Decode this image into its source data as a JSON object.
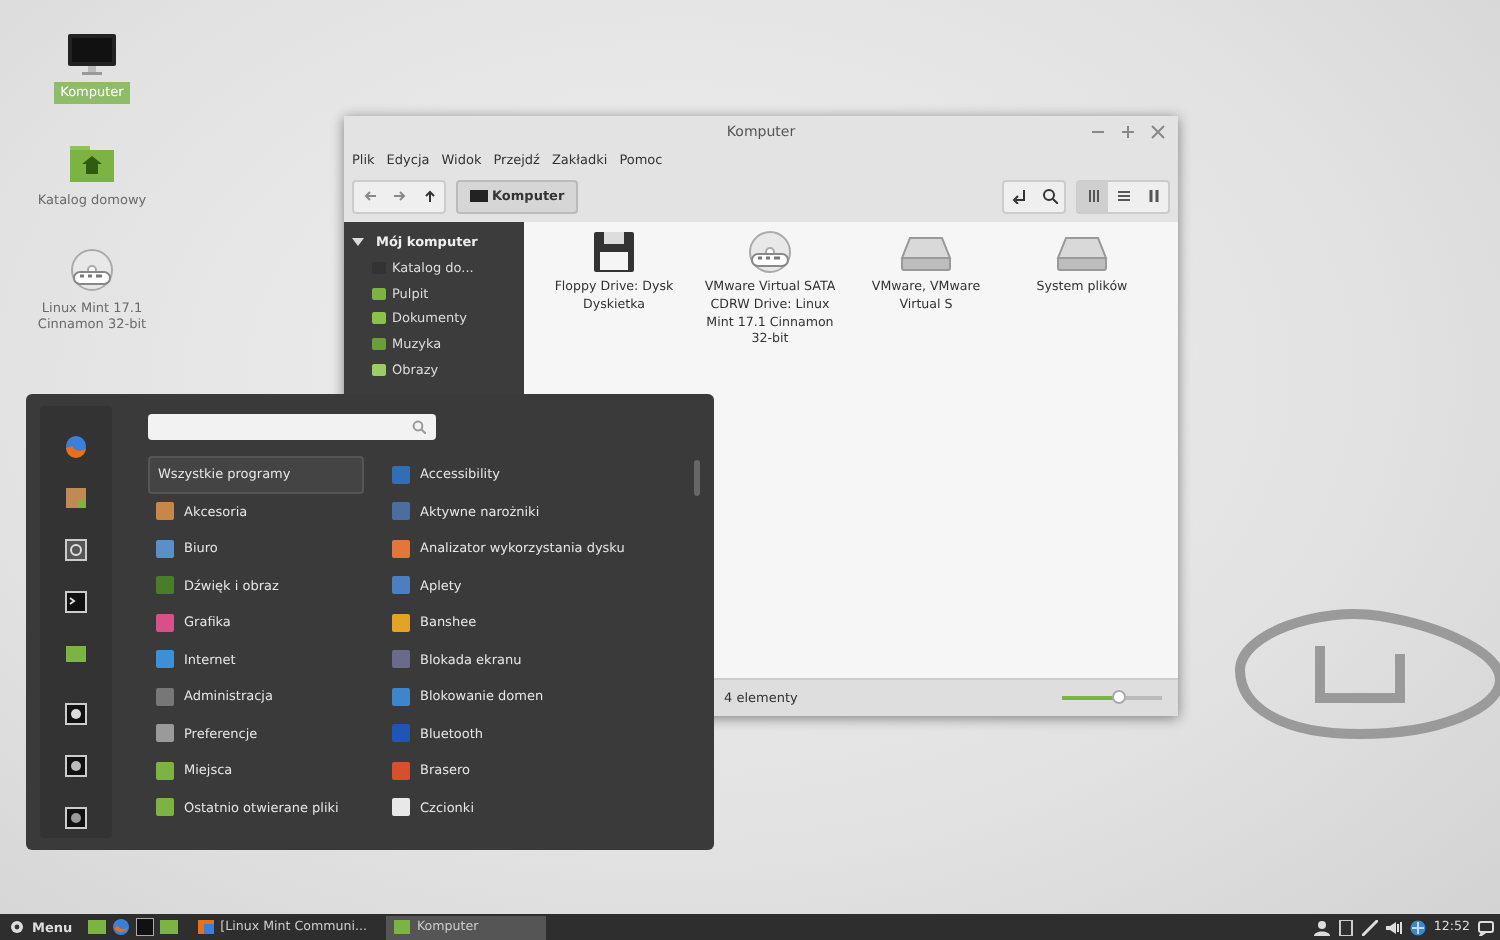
{
  "desktop_icons": [
    {
      "label": "Komputer",
      "kind": "monitor",
      "selected": true
    },
    {
      "label": "Katalog domowy",
      "kind": "folder",
      "selected": false
    },
    {
      "label": "Linux Mint 17.1 Cinnamon 32-bit",
      "kind": "dvd",
      "selected": false
    }
  ],
  "file_manager": {
    "title": "Komputer",
    "menu": [
      "Plik",
      "Edycja",
      "Widok",
      "Przejdź",
      "Zakładki",
      "Pomoc"
    ],
    "path_button": "Komputer",
    "view_modes": [
      {
        "kind": "icons",
        "selected": true
      },
      {
        "kind": "list",
        "selected": false
      },
      {
        "kind": "compact",
        "selected": false
      }
    ],
    "sidebar": {
      "heading": "Mój komputer",
      "expanded": true,
      "items": [
        {
          "label": "Katalog do...",
          "color": "#333333"
        },
        {
          "label": "Pulpit",
          "color": "#7cb342"
        },
        {
          "label": "Dokumenty",
          "color": "#8bc34a"
        },
        {
          "label": "Muzyka",
          "color": "#689f38"
        },
        {
          "label": "Obrazy",
          "color": "#9ccc65"
        }
      ]
    },
    "files": [
      {
        "label": "Floppy Drive: Dysk Dyskietka",
        "kind": "floppy"
      },
      {
        "label": "VMware Virtual SATA CDRW Drive: Linux Mint 17.1 Cinnamon 32-bit",
        "kind": "dvd"
      },
      {
        "label": "VMware, VMware Virtual S",
        "kind": "drive"
      },
      {
        "label": "System plików",
        "kind": "drive"
      }
    ],
    "status_bar": {
      "text": "4 elementy",
      "zoom": {
        "level": 0.55
      }
    }
  },
  "menu": {
    "categories": [
      {
        "label": "Wszystkie programy",
        "selected": true
      },
      {
        "label": "Akcesoria",
        "selected": false,
        "color": "#c8874a"
      },
      {
        "label": "Biuro",
        "selected": false,
        "color": "#5b8fc9"
      },
      {
        "label": "Dźwięk i obraz",
        "selected": false,
        "color": "#4a7d2a"
      },
      {
        "label": "Grafika",
        "selected": false,
        "color": "#d94f8a"
      },
      {
        "label": "Internet",
        "selected": false,
        "color": "#3d8fd6"
      },
      {
        "label": "Administracja",
        "selected": false,
        "color": "#777777"
      },
      {
        "label": "Preferencje",
        "selected": false,
        "color": "#9a9a9a"
      },
      {
        "label": "Miejsca",
        "selected": false,
        "color": "#7cb342"
      },
      {
        "label": "Ostatnio otwierane pliki",
        "selected": false,
        "color": "#7cb342"
      }
    ],
    "apps": [
      {
        "label": "Accessibility",
        "color": "#2f6fb8"
      },
      {
        "label": "Aktywne narożniki",
        "color": "#4a6ea0"
      },
      {
        "label": "Analizator wykorzystania dysku",
        "color": "#e2773c"
      },
      {
        "label": "Aplety",
        "color": "#4b7fc0"
      },
      {
        "label": "Banshee",
        "color": "#e3a326"
      },
      {
        "label": "Blokada ekranu",
        "color": "#6a6a8a"
      },
      {
        "label": "Blokowanie domen",
        "color": "#3d86cc"
      },
      {
        "label": "Bluetooth",
        "color": "#2155b5"
      },
      {
        "label": "Brasero",
        "color": "#d8502a"
      },
      {
        "label": "Czcionki",
        "color": "#e8e8e8"
      }
    ]
  },
  "taskbar": {
    "menu_label": "Menu",
    "windows": [
      {
        "label": "[Linux Mint Communi...",
        "selected": false
      },
      {
        "label": "Komputer",
        "selected": true
      }
    ],
    "clock": "12:52"
  }
}
